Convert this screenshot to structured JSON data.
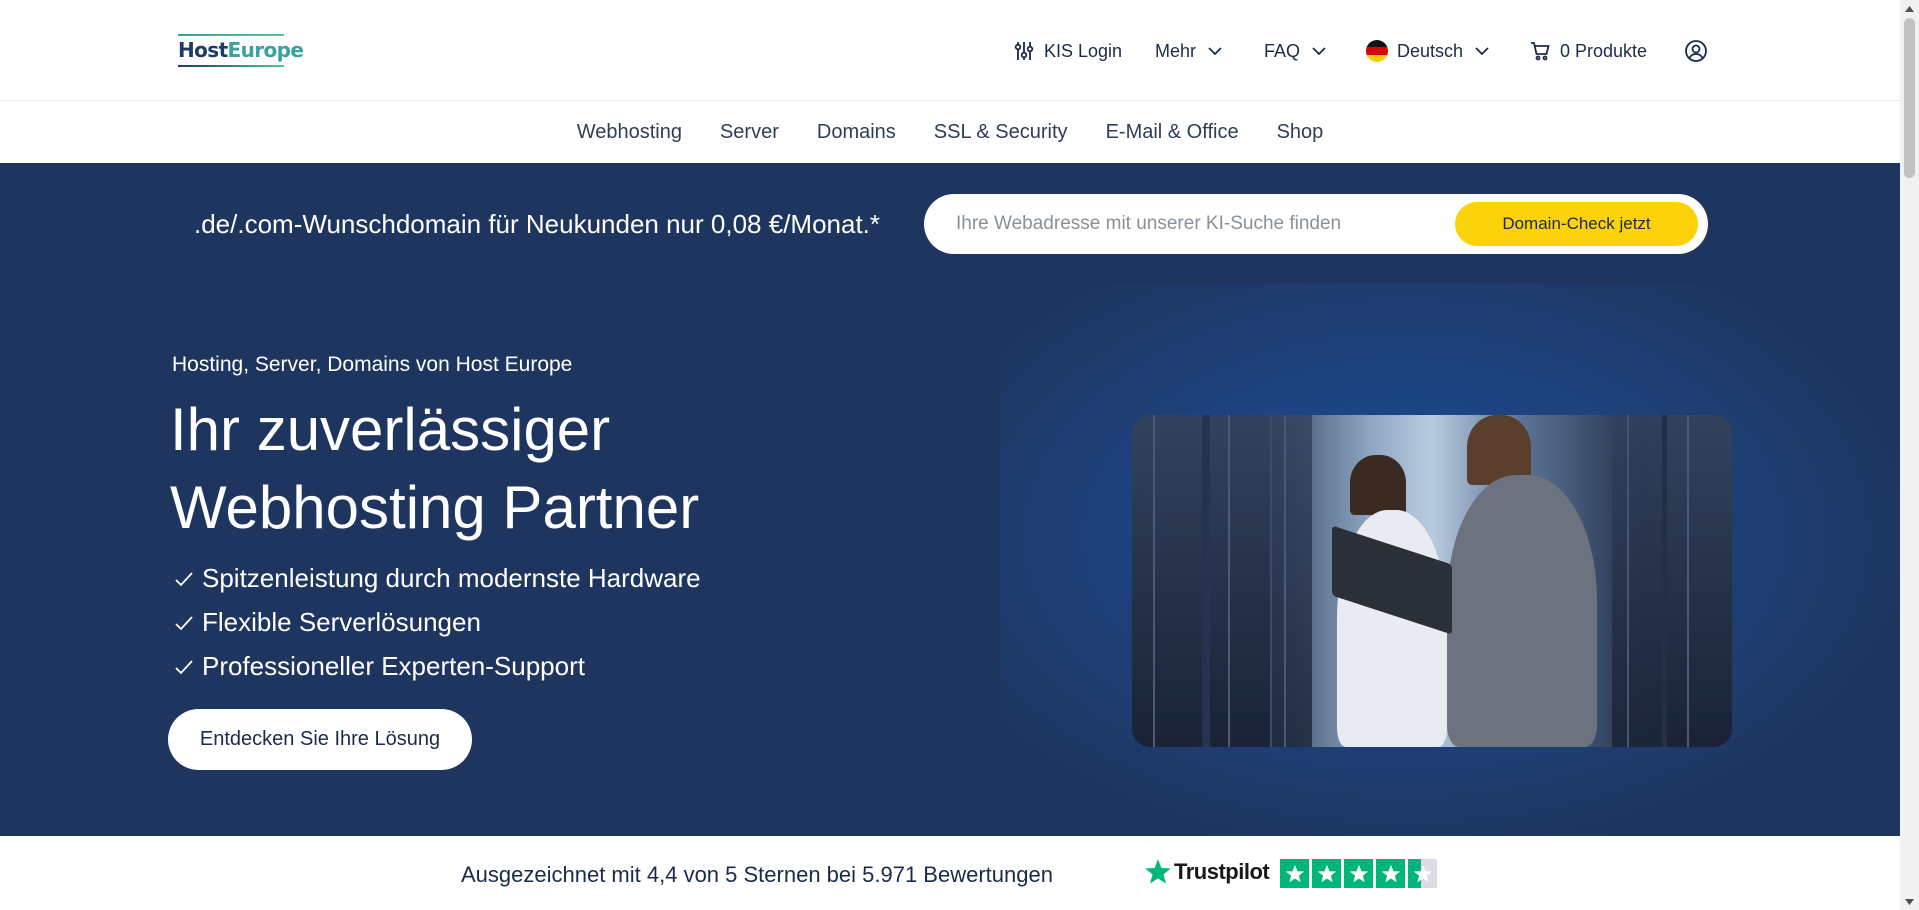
{
  "header": {
    "logo_host": "Host",
    "logo_europe": "Europe",
    "kis_login": "KIS Login",
    "mehr": "Mehr",
    "faq": "FAQ",
    "language": "Deutsch",
    "cart": "0 Produkte"
  },
  "nav": {
    "items": [
      "Webhosting",
      "Server",
      "Domains",
      "SSL & Security",
      "E-Mail & Office",
      "Shop"
    ]
  },
  "hero": {
    "promo": ".de/.com-Wunschdomain für Neukunden nur 0,08 €/Monat.*",
    "search_placeholder": "Ihre Webadresse mit unserer KI-Suche finden",
    "search_button": "Domain-Check jetzt",
    "kicker": "Hosting, Server, Domains von Host Europe",
    "headline_line1": "Ihr zuverlässiger",
    "headline_line2": "Webhosting Partner",
    "features": [
      "Spitzenleistung durch modernste Hardware",
      "Flexible Serverlösungen",
      "Professioneller Experten-Support"
    ],
    "cta": "Entdecken Sie Ihre Lösung"
  },
  "trust": {
    "text": "Ausgezeichnet mit 4,4 von 5 Sternen bei 5.971 Bewertungen",
    "brand": "Trustpilot",
    "rating": 4.4,
    "max_rating": 5
  },
  "colors": {
    "hero_bg": "#1e365f",
    "accent_yellow": "#fcd20a",
    "trustpilot_green": "#00b67a"
  },
  "icons": {
    "kis": "sliders-icon",
    "chevron": "chevron-down-icon",
    "flag": "german-flag-icon",
    "cart": "cart-icon",
    "account": "user-icon",
    "check": "check-icon",
    "trustpilot": "trustpilot-star-icon"
  }
}
